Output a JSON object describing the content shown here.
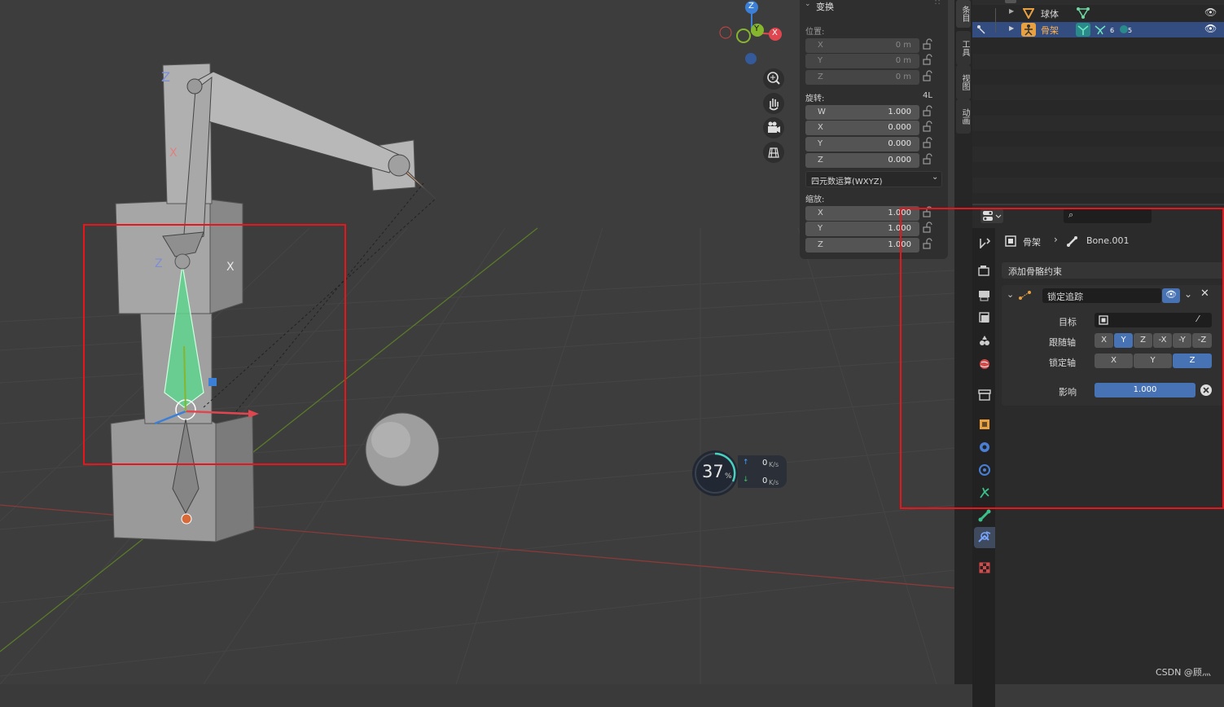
{
  "npanel": {
    "title": "变换",
    "location_label": "位置:",
    "location": [
      {
        "axis": "X",
        "value": "0 m"
      },
      {
        "axis": "Y",
        "value": "0 m"
      },
      {
        "axis": "Z",
        "value": "0 m"
      }
    ],
    "rotation_label": "旋转:",
    "rotation_mode_badge": "4L",
    "rotation": [
      {
        "axis": "W",
        "value": "1.000"
      },
      {
        "axis": "X",
        "value": "0.000"
      },
      {
        "axis": "Y",
        "value": "0.000"
      },
      {
        "axis": "Z",
        "value": "0.000"
      }
    ],
    "rotation_mode": "四元数运算(WXYZ)",
    "scale_label": "缩放:",
    "scale": [
      {
        "axis": "X",
        "value": "1.000"
      },
      {
        "axis": "Y",
        "value": "1.000"
      },
      {
        "axis": "Z",
        "value": "1.000"
      }
    ]
  },
  "vtabs": [
    "条目",
    "工具",
    "视图",
    "动画"
  ],
  "outliner": {
    "rows": [
      {
        "label": "球体",
        "selected": false
      },
      {
        "label": "骨架",
        "selected": true,
        "badge1": "6",
        "badge2": "5"
      }
    ]
  },
  "gizmo": {
    "z": "Z",
    "y": "Y",
    "x": "X"
  },
  "net_widget": {
    "percent": "37",
    "percent_sign": "%",
    "up": "0",
    "up_unit": "K/s",
    "down": "0",
    "down_unit": "K/s"
  },
  "props": {
    "breadcrumb_object": "骨架",
    "breadcrumb_bone": "Bone.001",
    "add_constraint": "添加骨骼约束",
    "constraint_name": "锁定追踪",
    "target_label": "目标",
    "track_axis_label": "跟随轴",
    "track_axis_options": [
      "X",
      "Y",
      "Z",
      "-X",
      "-Y",
      "-Z"
    ],
    "track_axis_selected": "Y",
    "lock_axis_label": "锁定轴",
    "lock_axis_options": [
      "X",
      "Y",
      "Z"
    ],
    "lock_axis_selected": "Z",
    "influence_label": "影响",
    "influence_value": "1.000"
  },
  "watermark": "CSDN @顾灬",
  "colors": {
    "accent": "#4772b3",
    "highlight_box": "#e8151b",
    "bone_active": "#5fd38d",
    "axis_x": "#e0464f",
    "axis_y": "#86b52e",
    "axis_z": "#3b7fd6"
  }
}
